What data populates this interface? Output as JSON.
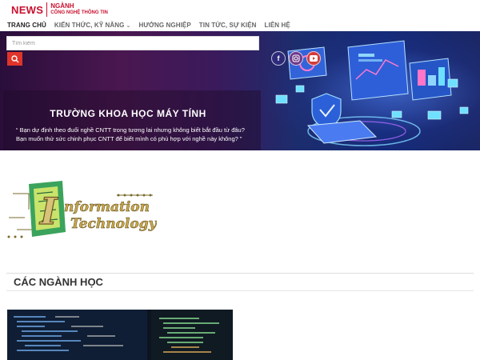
{
  "logo": {
    "news": "NEWS",
    "line1": "NGÀNH",
    "line2": "CÔNG NGHỆ THÔNG TIN"
  },
  "nav": [
    {
      "label": "TRANG CHỦ",
      "active": true
    },
    {
      "label": "KIẾN THỨC, KỸ NĂNG",
      "has_dropdown": true
    },
    {
      "label": "HƯỚNG NGHIỆP"
    },
    {
      "label": "TIN TỨC, SỰ KIỆN"
    },
    {
      "label": "LIÊN HỆ"
    }
  ],
  "search": {
    "placeholder": "Tìm kiếm"
  },
  "socials": [
    "facebook-icon",
    "instagram-icon",
    "youtube-icon"
  ],
  "hero": {
    "title": "TRƯỜNG KHOA HỌC MÁY TÍNH",
    "description": "“ Bạn dự định theo đuổi nghề CNTT trong tương lai nhưng không biết bắt đầu từ đâu? Bạn muốn thử sức chinh phục CNTT để biết mình có phù hợp với nghề này không? ”"
  },
  "it_logo": {
    "word1": "nformation",
    "word2": "Technology",
    "letter": "I"
  },
  "section": {
    "title": "CÁC NGÀNH HỌC"
  },
  "colors": {
    "brand": "#c8102e",
    "search_button": "#e0342a"
  }
}
